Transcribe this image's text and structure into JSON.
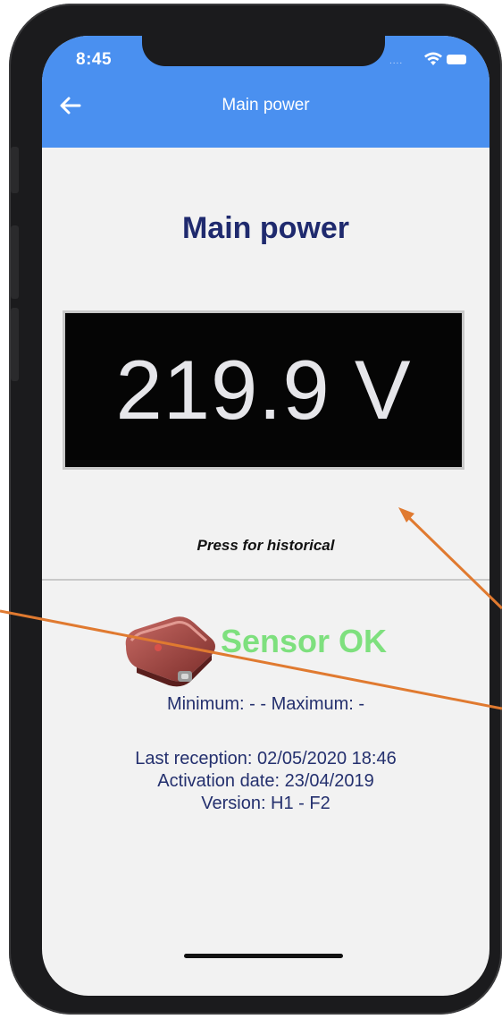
{
  "status_bar": {
    "time": "8:45",
    "signal": "....",
    "wifi_icon": "wifi-icon",
    "battery_icon": "battery-icon"
  },
  "app_bar": {
    "back_icon": "arrow-left-icon",
    "title": "Main power"
  },
  "main": {
    "heading": "Main power",
    "reading": "219.9 V",
    "hint": "Press for historical"
  },
  "sensor": {
    "image_icon": "sensor-device-image",
    "status": "Sensor OK",
    "status_color": "#7ee07e"
  },
  "stats": {
    "min_max": "Minimum: - - Maximum: -"
  },
  "details": {
    "last_reception": "Last reception: 02/05/2020 18:46",
    "activation_date": "Activation date: 23/04/2019",
    "version": "Version: H1 - F2"
  },
  "colors": {
    "app_bar": "#4a90f0",
    "heading": "#1f2a6e",
    "text": "#24306e",
    "annotation_arrow": "#e07a30",
    "display_bg": "#050505"
  }
}
